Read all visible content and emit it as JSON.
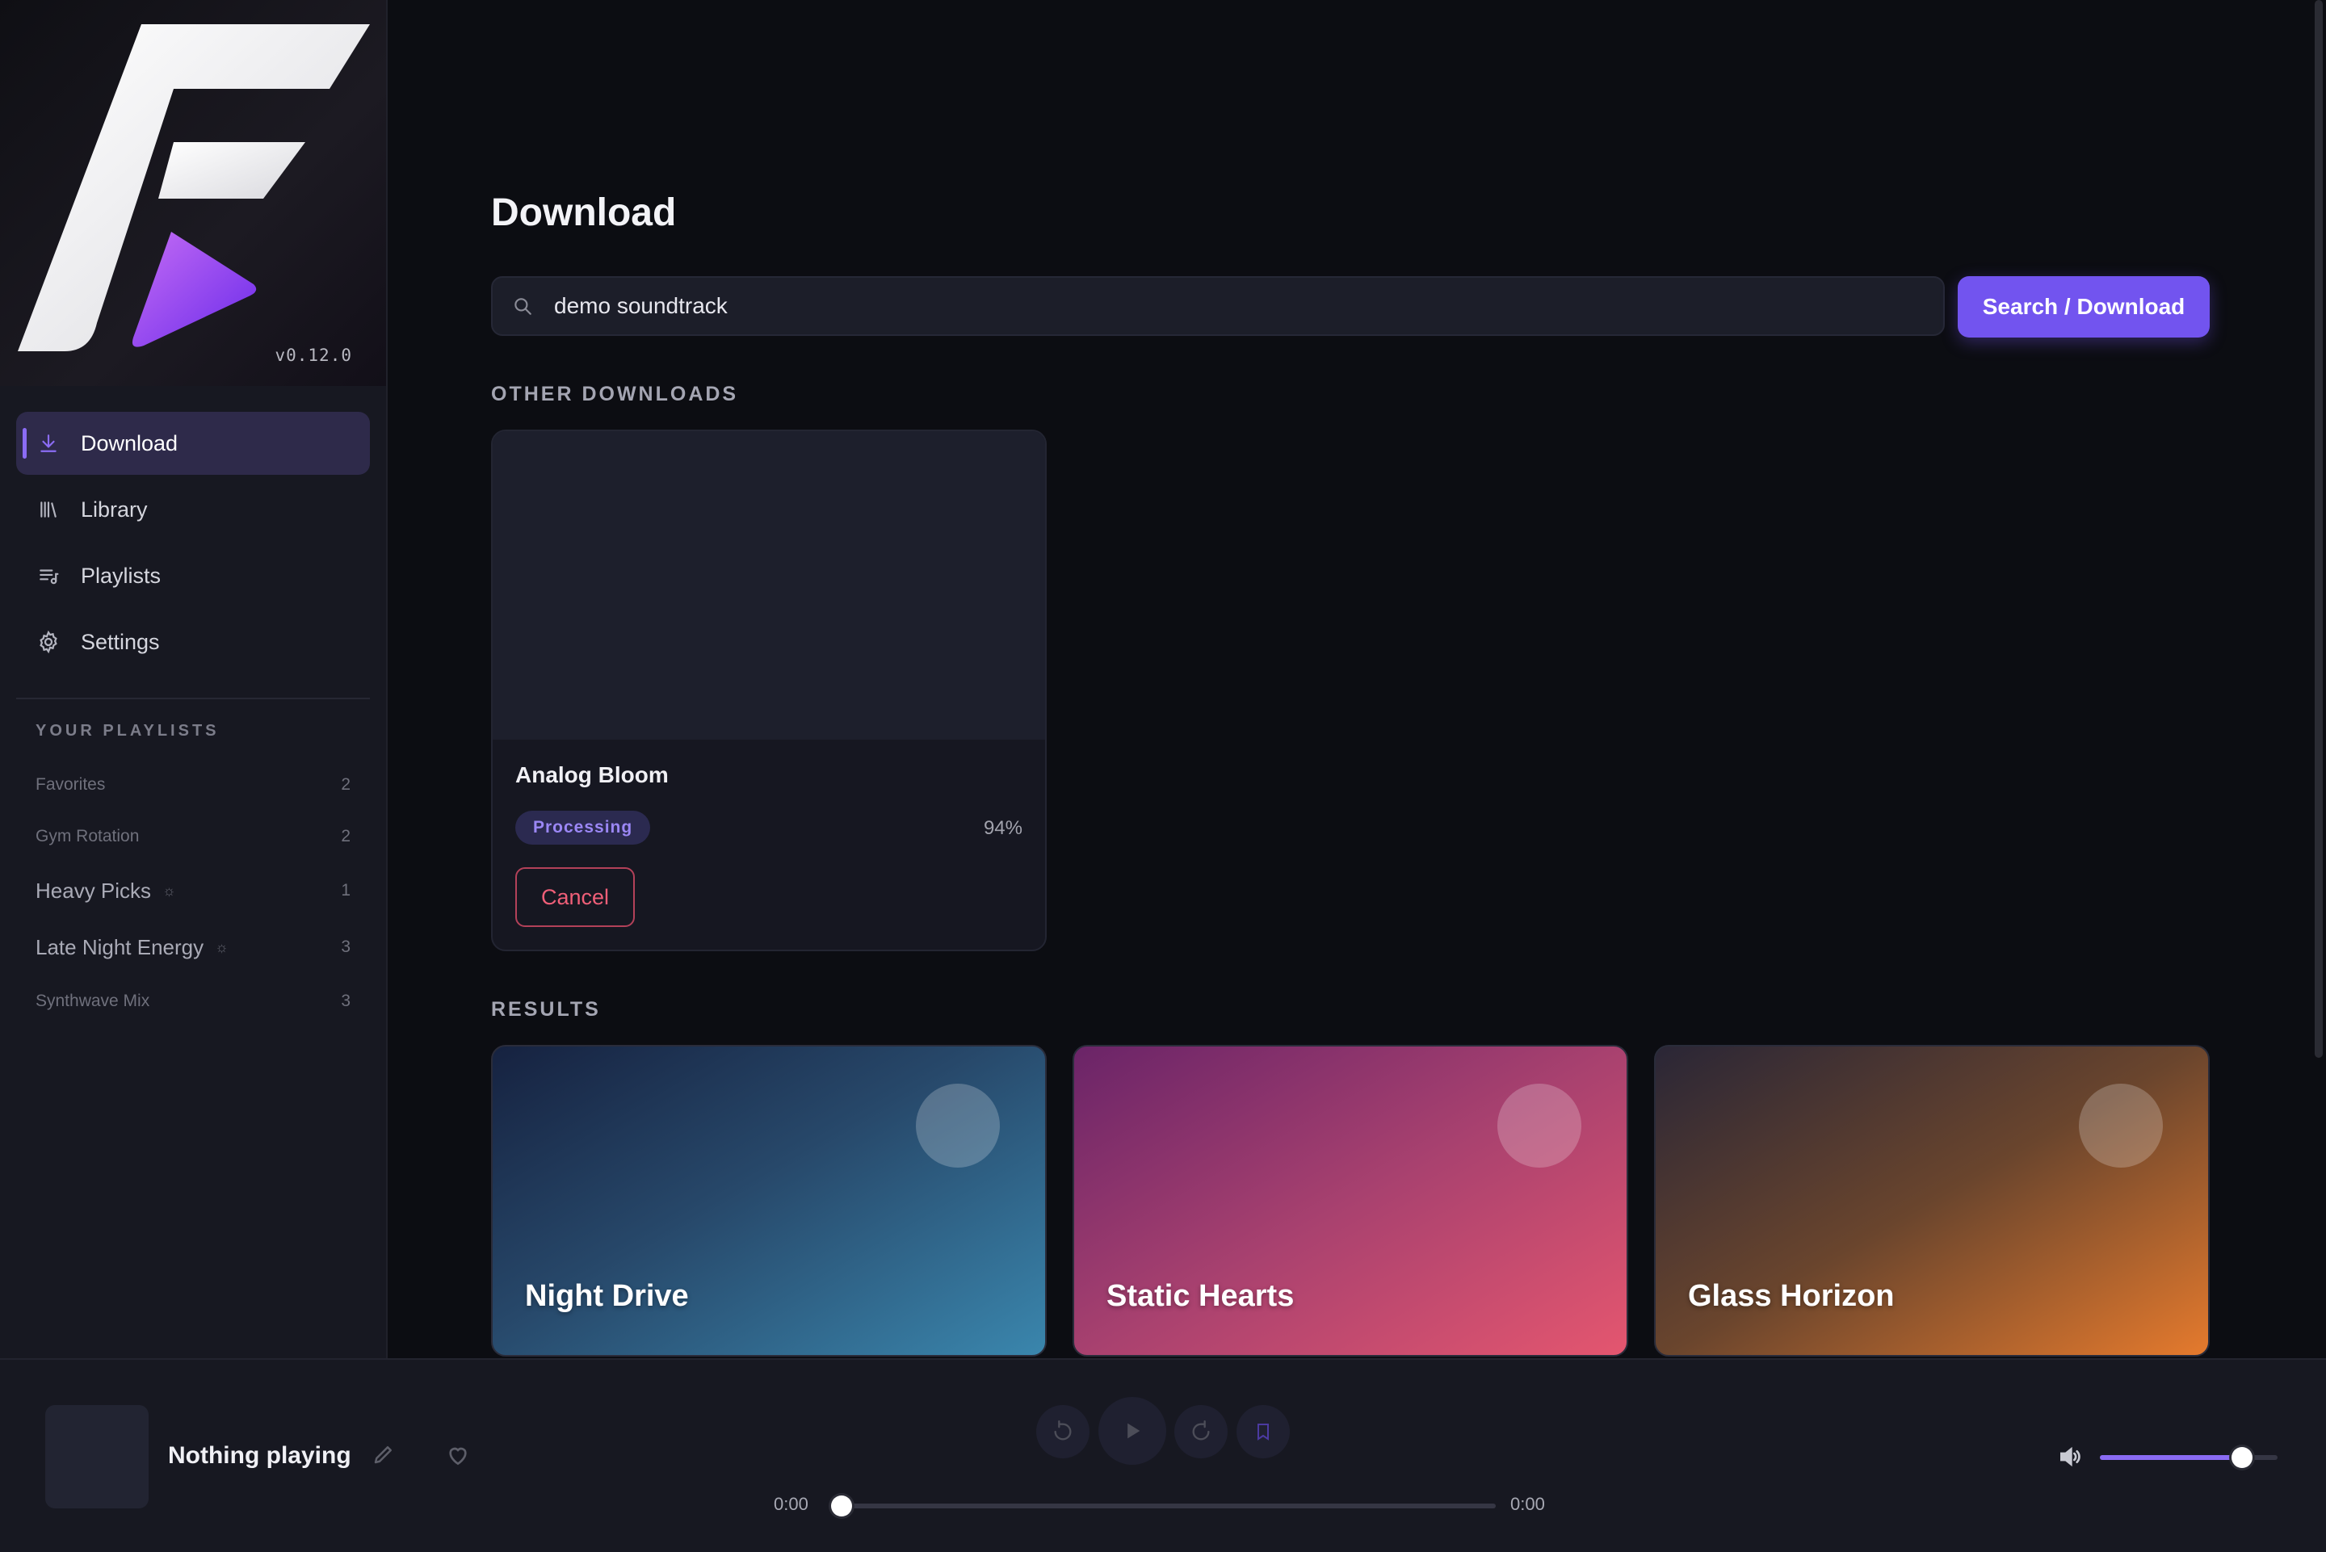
{
  "app": {
    "version": "v0.12.0",
    "accent_color": "#7254ef"
  },
  "sidebar": {
    "nav": [
      {
        "label": "Download",
        "icon": "download-icon",
        "active": true
      },
      {
        "label": "Library",
        "icon": "library-icon",
        "active": false
      },
      {
        "label": "Playlists",
        "icon": "playlist-icon",
        "active": false
      },
      {
        "label": "Settings",
        "icon": "gear-icon",
        "active": false
      }
    ],
    "playlists_heading": "YOUR PLAYLISTS",
    "playlists": [
      {
        "name": "Favorites",
        "count": "2",
        "generated": false
      },
      {
        "name": "Gym Rotation",
        "count": "2",
        "generated": false
      },
      {
        "name": "Heavy Picks",
        "count": "1",
        "generated": true
      },
      {
        "name": "Late Night Energy",
        "count": "3",
        "generated": true
      },
      {
        "name": "Synthwave Mix",
        "count": "3",
        "generated": false
      }
    ]
  },
  "main": {
    "title": "Download",
    "search": {
      "value": "demo soundtrack",
      "placeholder": "",
      "button_label": "Search / Download"
    },
    "other_downloads_label": "OTHER DOWNLOADS",
    "downloads": [
      {
        "title": "Analog Bloom",
        "status": "Processing",
        "progress": "94%",
        "cancel_label": "Cancel"
      }
    ],
    "results_label": "RESULTS",
    "results": [
      {
        "title": "Night Drive",
        "gradient": [
          "#162240",
          "#3a86ad"
        ]
      },
      {
        "title": "Static Hearts",
        "gradient": [
          "#6a2468",
          "#e4566f"
        ]
      },
      {
        "title": "Glass Horizon",
        "gradient": [
          "#2a2636",
          "#e57a2d"
        ]
      }
    ]
  },
  "player": {
    "now_playing": "Nothing playing",
    "elapsed": "0:00",
    "duration": "0:00",
    "progress": 0,
    "volume": 0.8
  }
}
